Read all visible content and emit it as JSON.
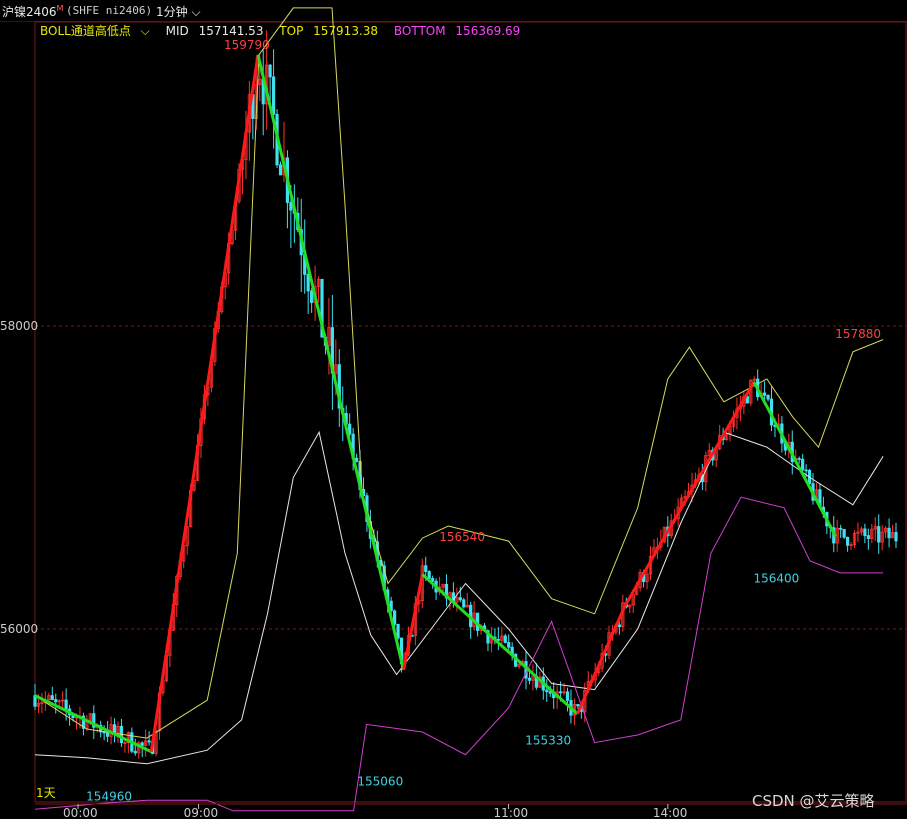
{
  "toolbar": {
    "symbol": "沪镍2406",
    "symbol_marker": "M",
    "code": "(SHFE ni2406)",
    "period": "1分钟"
  },
  "indicator": {
    "name": "BOLL通道高低点",
    "mid_label": "MID",
    "mid_value": "157141.53",
    "top_label": "TOP",
    "top_value": "157913.38",
    "bottom_label": "BOTTOM",
    "bottom_value": "156369.69",
    "colors": {
      "name": "#e8e800",
      "mid": "#e8e8e8",
      "top": "#e8e800",
      "bottom": "#ff40ff"
    }
  },
  "watermark": "CSDN @艾云策略",
  "range_label": "1天",
  "chart_data": {
    "type": "line",
    "ylim": [
      154800,
      160100
    ],
    "y_ticks": [
      {
        "value": 156000,
        "label": "56000"
      },
      {
        "value": 158000,
        "label": "58000"
      }
    ],
    "x_ticks": [
      {
        "t": 0.05,
        "label": "00:00"
      },
      {
        "t": 0.19,
        "label": "09:00"
      },
      {
        "t": 0.55,
        "label": "11:00"
      },
      {
        "t": 0.735,
        "label": "14:00"
      }
    ],
    "colors": {
      "up": "#ff3030",
      "down": "#40e0f0",
      "zig_up": "#ff1a1a",
      "zig_down": "#22dd22",
      "mid": "#e8e8e8",
      "top": "#d8d860",
      "bottom": "#d040d0",
      "grid": "#7a1818"
    },
    "price_labels": [
      {
        "t": 0.245,
        "value": 159790,
        "label": "159790",
        "kind": "high"
      },
      {
        "t": 0.085,
        "value": 154960,
        "label": "154960",
        "kind": "low"
      },
      {
        "t": 0.4,
        "value": 155060,
        "label": "155060",
        "kind": "low"
      },
      {
        "t": 0.495,
        "value": 156540,
        "label": "156540",
        "kind": "high"
      },
      {
        "t": 0.595,
        "value": 155330,
        "label": "155330",
        "kind": "low"
      },
      {
        "t": 0.86,
        "value": 156400,
        "label": "156400",
        "kind": "low"
      },
      {
        "t": 0.955,
        "value": 157880,
        "label": "157880",
        "kind": "high"
      }
    ],
    "zigzag": [
      {
        "t": 0.0,
        "v": 155560
      },
      {
        "t": 0.135,
        "v": 155190
      },
      {
        "t": 0.259,
        "v": 159790
      },
      {
        "t": 0.428,
        "v": 155730
      },
      {
        "t": 0.45,
        "v": 156360
      },
      {
        "t": 0.63,
        "v": 155440
      },
      {
        "t": 0.685,
        "v": 156150
      },
      {
        "t": 0.835,
        "v": 157630
      },
      {
        "t": 0.93,
        "v": 156610
      }
    ],
    "mid": [
      {
        "t": 0.0,
        "v": 155170
      },
      {
        "t": 0.06,
        "v": 155150
      },
      {
        "t": 0.13,
        "v": 155110
      },
      {
        "t": 0.2,
        "v": 155200
      },
      {
        "t": 0.24,
        "v": 155400
      },
      {
        "t": 0.27,
        "v": 156100
      },
      {
        "t": 0.3,
        "v": 157000
      },
      {
        "t": 0.33,
        "v": 157300
      },
      {
        "t": 0.36,
        "v": 156500
      },
      {
        "t": 0.39,
        "v": 155960
      },
      {
        "t": 0.42,
        "v": 155700
      },
      {
        "t": 0.46,
        "v": 156000
      },
      {
        "t": 0.5,
        "v": 156300
      },
      {
        "t": 0.55,
        "v": 156000
      },
      {
        "t": 0.6,
        "v": 155640
      },
      {
        "t": 0.65,
        "v": 155600
      },
      {
        "t": 0.7,
        "v": 156000
      },
      {
        "t": 0.75,
        "v": 156700
      },
      {
        "t": 0.8,
        "v": 157300
      },
      {
        "t": 0.85,
        "v": 157200
      },
      {
        "t": 0.9,
        "v": 157000
      },
      {
        "t": 0.95,
        "v": 156820
      },
      {
        "t": 0.985,
        "v": 157140
      }
    ],
    "top": [
      {
        "t": 0.0,
        "v": 155560
      },
      {
        "t": 0.06,
        "v": 155340
      },
      {
        "t": 0.13,
        "v": 155280
      },
      {
        "t": 0.2,
        "v": 155530
      },
      {
        "t": 0.235,
        "v": 156500
      },
      {
        "t": 0.26,
        "v": 159790
      },
      {
        "t": 0.3,
        "v": 160100
      },
      {
        "t": 0.345,
        "v": 160100
      },
      {
        "t": 0.36,
        "v": 158800
      },
      {
        "t": 0.38,
        "v": 156900
      },
      {
        "t": 0.41,
        "v": 156300
      },
      {
        "t": 0.45,
        "v": 156600
      },
      {
        "t": 0.48,
        "v": 156680
      },
      {
        "t": 0.55,
        "v": 156580
      },
      {
        "t": 0.6,
        "v": 156200
      },
      {
        "t": 0.65,
        "v": 156100
      },
      {
        "t": 0.7,
        "v": 156800
      },
      {
        "t": 0.735,
        "v": 157650
      },
      {
        "t": 0.76,
        "v": 157860
      },
      {
        "t": 0.8,
        "v": 157500
      },
      {
        "t": 0.85,
        "v": 157650
      },
      {
        "t": 0.88,
        "v": 157400
      },
      {
        "t": 0.91,
        "v": 157200
      },
      {
        "t": 0.95,
        "v": 157830
      },
      {
        "t": 0.985,
        "v": 157910
      }
    ],
    "bottom": [
      {
        "t": 0.0,
        "v": 154810
      },
      {
        "t": 0.08,
        "v": 154850
      },
      {
        "t": 0.13,
        "v": 154870
      },
      {
        "t": 0.2,
        "v": 154870
      },
      {
        "t": 0.23,
        "v": 154800
      },
      {
        "t": 0.37,
        "v": 154800
      },
      {
        "t": 0.385,
        "v": 155370
      },
      {
        "t": 0.45,
        "v": 155320
      },
      {
        "t": 0.5,
        "v": 155170
      },
      {
        "t": 0.55,
        "v": 155480
      },
      {
        "t": 0.6,
        "v": 156050
      },
      {
        "t": 0.65,
        "v": 155250
      },
      {
        "t": 0.7,
        "v": 155300
      },
      {
        "t": 0.75,
        "v": 155400
      },
      {
        "t": 0.785,
        "v": 156500
      },
      {
        "t": 0.82,
        "v": 156870
      },
      {
        "t": 0.87,
        "v": 156800
      },
      {
        "t": 0.9,
        "v": 156450
      },
      {
        "t": 0.935,
        "v": 156370
      },
      {
        "t": 0.985,
        "v": 156370
      }
    ]
  }
}
